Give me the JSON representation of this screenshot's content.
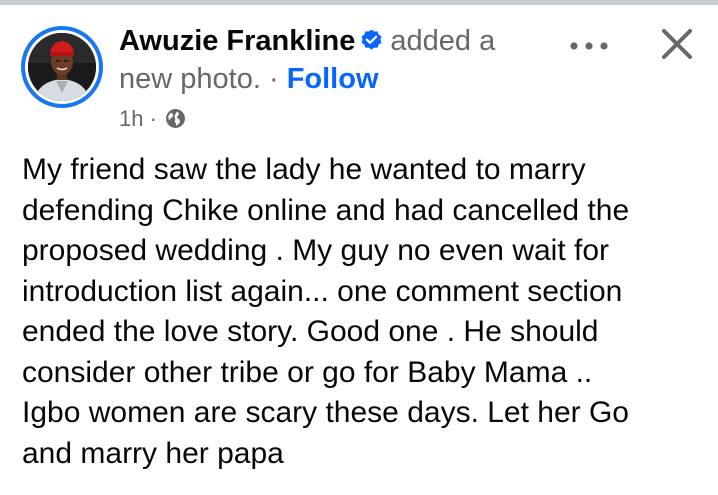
{
  "post": {
    "author_name": "Awuzie Frankline",
    "action_text": "added a",
    "action_text_2": "new photo.",
    "separator": "·",
    "follow_label": "Follow",
    "time": "1h",
    "time_separator": "·",
    "privacy_icon": "globe-icon",
    "verified_icon": "verified-badge-icon",
    "more_icon": "more-options-icon",
    "close_icon": "close-icon",
    "body_lines": [
      "My friend saw the lady he wanted to marry",
      "defending Chike online and had cancelled the",
      "proposed wedding . My guy no even wait for",
      "introduction list again... one comment section",
      "ended the love story. Good one . He should",
      "consider other tribe or go for Baby Mama  ..",
      "Igbo women are scary these days. Let her Go",
      "and marry her papa"
    ]
  },
  "colors": {
    "text": "#080809",
    "muted": "#65676b",
    "accent": "#0866ff",
    "avatar_ring": "#1877f2"
  }
}
